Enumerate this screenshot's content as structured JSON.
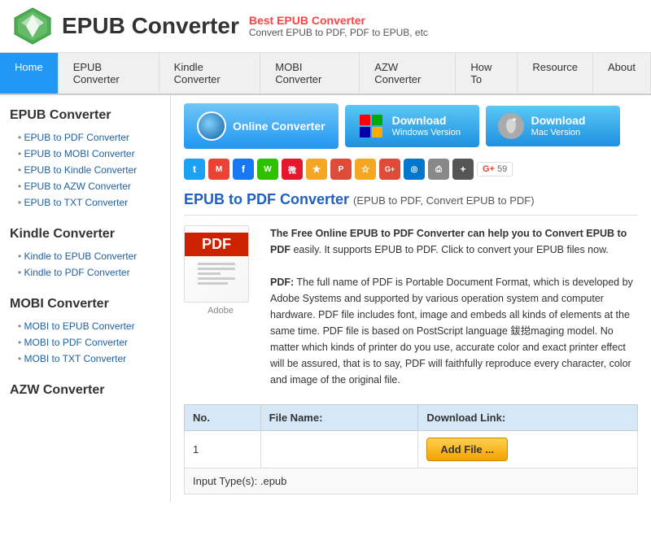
{
  "header": {
    "logo_text": "EPUB Converter",
    "tagline_best": "Best EPUB Converter",
    "tagline_sub": "Convert EPUB to PDF, PDF to EPUB, etc"
  },
  "nav": {
    "items": [
      {
        "label": "Home",
        "active": true
      },
      {
        "label": "EPUB Converter",
        "active": false
      },
      {
        "label": "Kindle Converter",
        "active": false
      },
      {
        "label": "MOBI Converter",
        "active": false
      },
      {
        "label": "AZW Converter",
        "active": false
      },
      {
        "label": "How To",
        "active": false
      },
      {
        "label": "Resource",
        "active": false
      },
      {
        "label": "About",
        "active": false
      }
    ]
  },
  "download_buttons": {
    "online": "Online Converter",
    "windows_main": "Download",
    "windows_sub": "Windows Version",
    "mac_main": "Download",
    "mac_sub": "Mac Version"
  },
  "social": {
    "gplus_count": "59"
  },
  "sidebar": {
    "sections": [
      {
        "title": "EPUB Converter",
        "links": [
          "EPUB to PDF Converter",
          "EPUB to MOBI Converter",
          "EPUB to Kindle Converter",
          "EPUB to AZW Converter",
          "EPUB to TXT Converter"
        ]
      },
      {
        "title": "Kindle Converter",
        "links": [
          "Kindle to EPUB Converter",
          "Kindle to PDF Converter"
        ]
      },
      {
        "title": "MOBI Converter",
        "links": [
          "MOBI to EPUB Converter",
          "MOBI to PDF Converter",
          "MOBI to TXT Converter"
        ]
      },
      {
        "title": "AZW Converter",
        "links": []
      }
    ]
  },
  "main_content": {
    "title": "EPUB to PDF Converter",
    "title_sub": "(EPUB to PDF, Convert EPUB to PDF)",
    "pdf_label": "PDF",
    "adobe_label": "Adobe",
    "description_bold": "The Free Online EPUB to PDF Converter can help you to Convert EPUB to PDF",
    "description1": " easily. It supports EPUB to PDF. Click to convert your EPUB files now.",
    "description2": "PDF: The full name of PDF is Portable Document Format, which is developed by Adobe Systems and supported by various operation system and computer hardware. PDF file includes font, image and embeds all kinds of elements at the same time. PDF file is based on PostScript language 鈸搃maging model. No matter which kinds of printer do you use, accurate color and exact printer effect will be assured, that is to say, PDF will faithfully reproduce every character, color and image of the original file.",
    "table": {
      "col1": "No.",
      "col2": "File Name:",
      "col3": "Download Link:",
      "rows": [
        {
          "no": "1",
          "filename": "",
          "link": "Add File ..."
        }
      ],
      "footer": "Input Type(s): .epub"
    }
  }
}
